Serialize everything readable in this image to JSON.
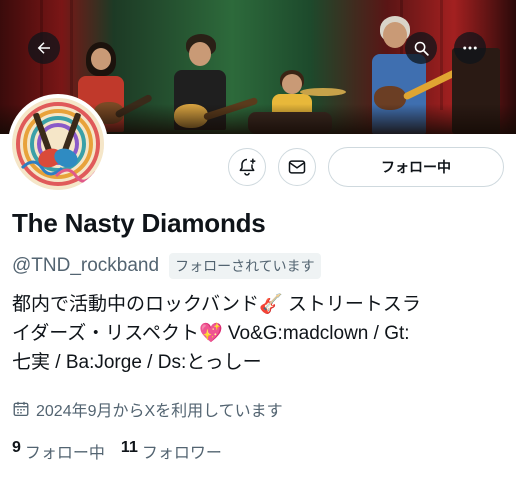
{
  "header": {
    "back_icon": "arrow-left-icon",
    "search_icon": "search-icon",
    "more_icon": "more-vertical-icon"
  },
  "actions": {
    "notify_icon": "bell-plus-icon",
    "message_icon": "envelope-icon",
    "follow_label": "フォロー中"
  },
  "profile": {
    "name": "The Nasty Diamonds",
    "handle": "@TND_rockband",
    "follows_you": "フォローされています",
    "bio_line1": "都内で活動中のロックバンド🎸 ストリートスラ",
    "bio_line2": "イダーズ・リスペクト💖 Vo&G:madclown / Gt:",
    "bio_line3": "七実 / Ba:Jorge / Ds:とっしー",
    "joined": "2024年9月からXを利用しています",
    "joined_icon": "calendar-icon"
  },
  "stats": {
    "following_count": "9",
    "following_label": "フォロー中",
    "followers_count": "11",
    "followers_label": "フォロワー"
  },
  "colors": {
    "text_primary": "#0f1419",
    "text_secondary": "#536471",
    "border": "#cfd9de",
    "pill_bg": "#eff3f4"
  }
}
